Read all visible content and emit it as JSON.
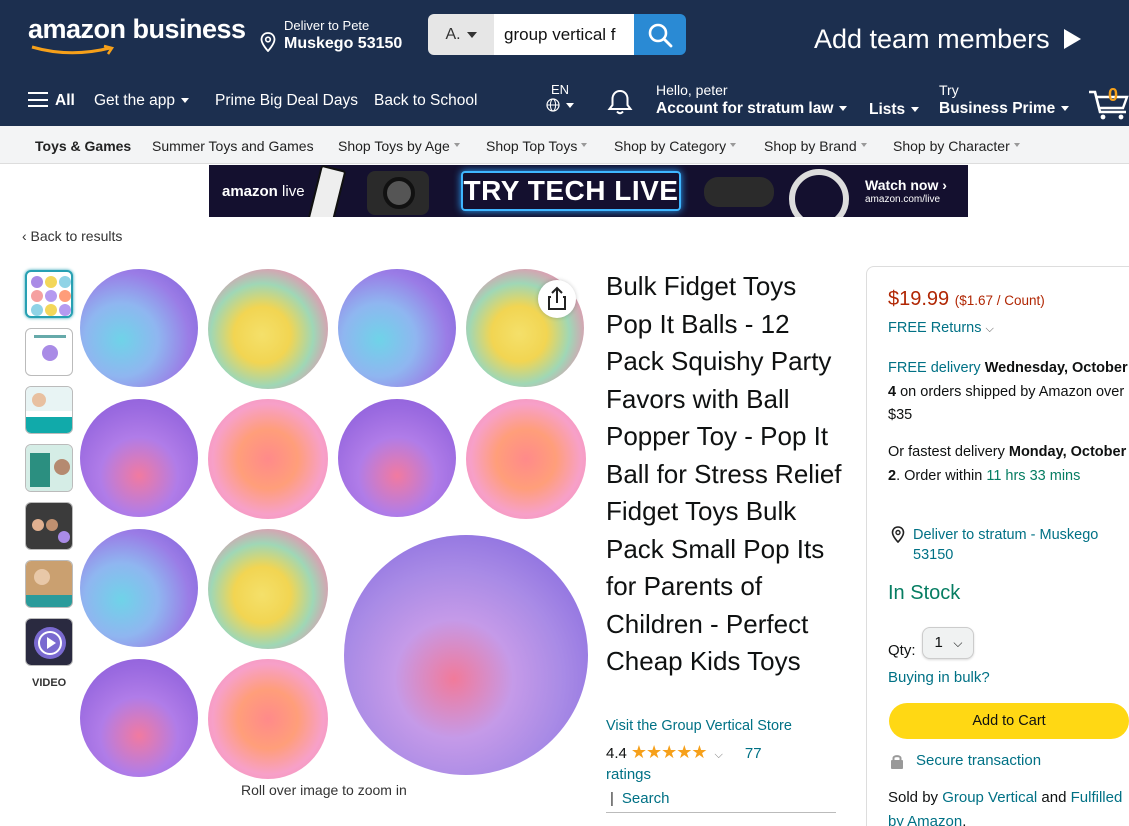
{
  "header": {
    "logo_text": "amazon business",
    "deliver_line1": "Deliver to Pete",
    "deliver_line2": "Muskego 53150",
    "search_category": "A.",
    "search_value": "group vertical f",
    "add_team": "Add team members"
  },
  "nav": {
    "all": "All",
    "get_app": "Get the app",
    "prime_deal": "Prime Big Deal Days",
    "back_school": "Back to School",
    "lang": "EN",
    "hello": "Hello, peter",
    "account": "Account for stratum law",
    "lists": "Lists",
    "try": "Try",
    "business_prime": "Business Prime",
    "cart_count": "0"
  },
  "subnav": {
    "items": [
      "Toys & Games",
      "Summer Toys and Games",
      "Shop Toys by Age",
      "Shop Top Toys",
      "Shop by Category",
      "Shop by Brand",
      "Shop by Character"
    ]
  },
  "banner": {
    "brand": "amazon",
    "brand_suffix": " live",
    "headline": "TRY TECH LIVE",
    "cta": "Watch now ›",
    "cta_url": "amazon.com/live"
  },
  "breadcrumb": "‹ Back to results",
  "gallery": {
    "video_label": "VIDEO",
    "rollover": "Roll over image to zoom in"
  },
  "product": {
    "title": "Bulk Fidget Toys Pop It Balls - 12 Pack Squishy Party Favors with Ball Popper Toy - Pop It Ball for Stress Relief Fidget Toys Bulk Pack Small Pop Its for Parents of Children - Perfect Cheap Kids Toys",
    "store_link": "Visit the Group Vertical Store",
    "rating": "4.4",
    "stars": "★★★★★",
    "rating_count": "77",
    "ratings_word": "ratings",
    "search_sep": "|",
    "search_link": "Search"
  },
  "buybox": {
    "price": "$19.99",
    "unit_price": "($1.67 / Count)",
    "returns": "FREE Returns",
    "free_delivery": "FREE delivery",
    "delivery_date": "Wednesday, October 4",
    "delivery_suffix": " on orders shipped by Amazon over $35",
    "fastest_prefix": "Or fastest delivery ",
    "fastest_date": "Monday, October 2",
    "fastest_mid": ". Order within ",
    "fastest_time": "11 hrs 33 mins",
    "deliver_to": "Deliver to stratum - Muskego 53150",
    "stock": "In Stock",
    "qty_label": "Qty:",
    "qty_value": "1",
    "bulk": "Buying in bulk?",
    "add_to_cart": "Add to Cart",
    "secure": "Secure transaction",
    "sold_prefix": "Sold by ",
    "seller": "Group Vertical",
    "sold_mid": " and ",
    "fulfilled": "Fulfilled by Amazon",
    "sold_end": "."
  },
  "colors": {
    "nav_bg": "#1c2f4f",
    "link": "#007185",
    "price": "#b12704",
    "stock_green": "#067d62",
    "cart_button": "#ffd814"
  }
}
